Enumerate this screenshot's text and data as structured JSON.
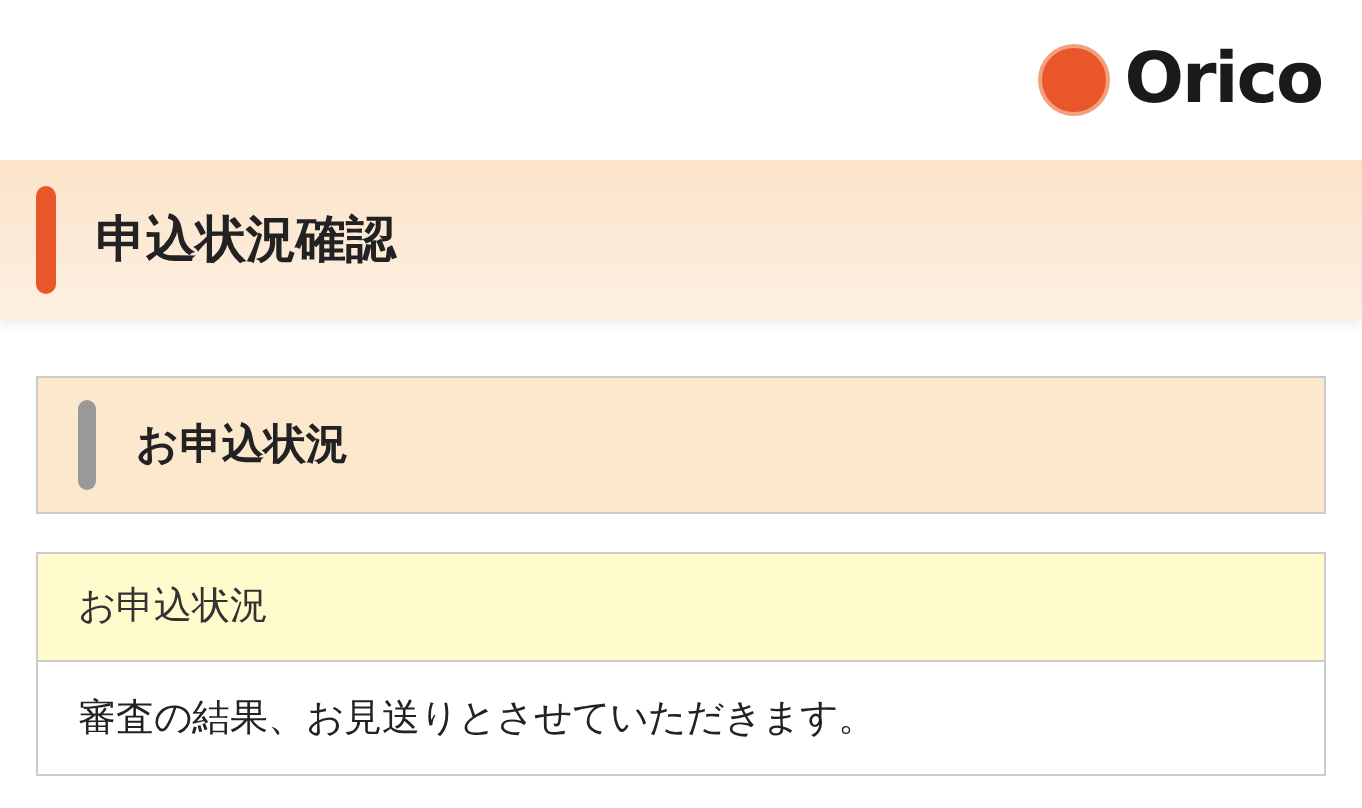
{
  "logo": {
    "text": "Orico"
  },
  "page_title": "申込状況確認",
  "section": {
    "heading": "お申込状況"
  },
  "table": {
    "label": "お申込状況",
    "value": "審査の結果、お見送りとさせていただきます。"
  }
}
